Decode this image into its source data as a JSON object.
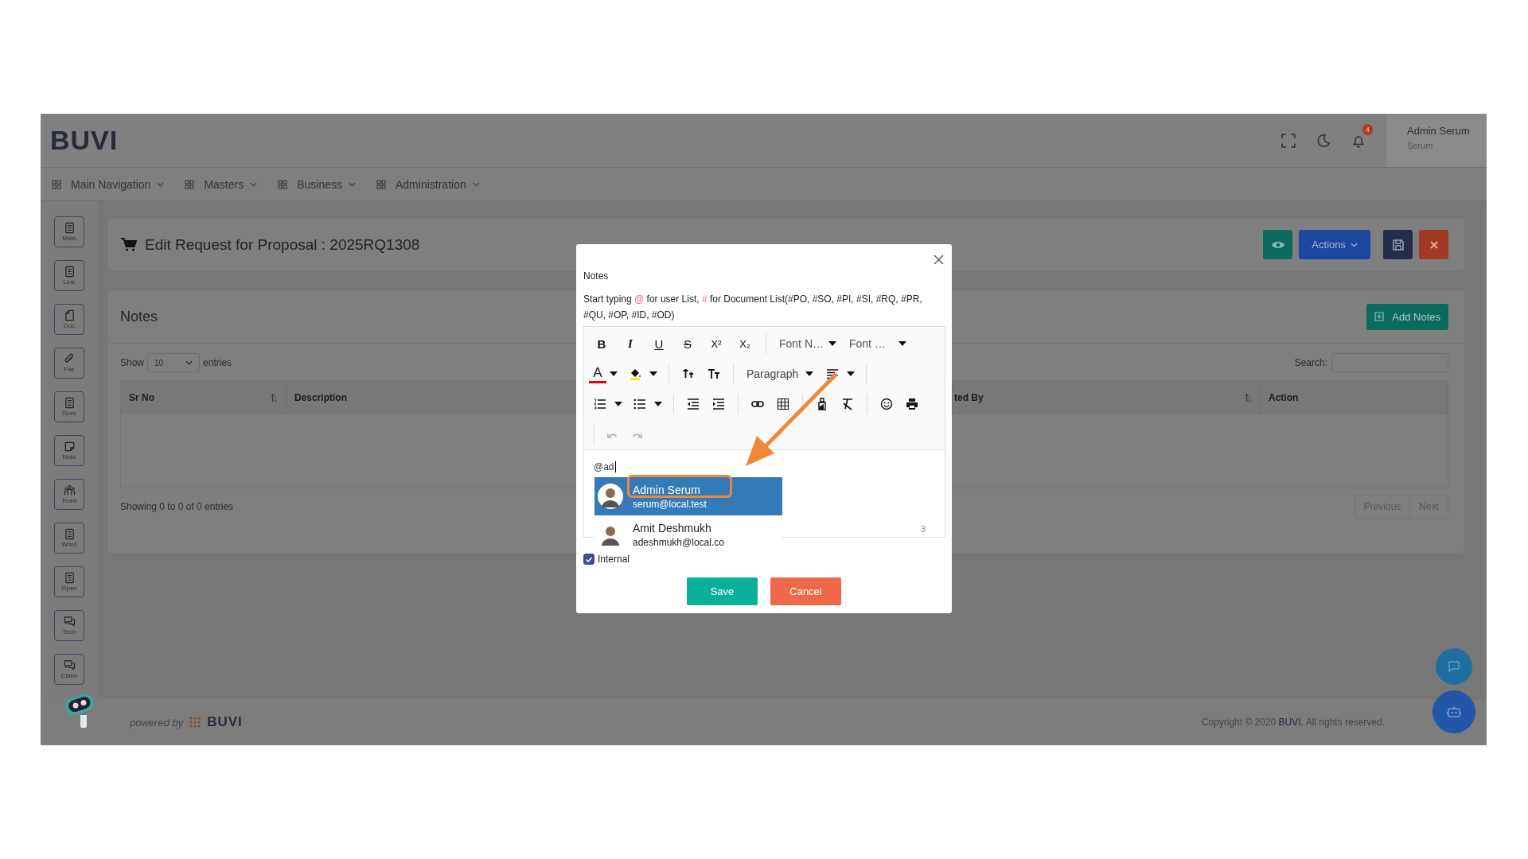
{
  "header": {
    "logo": "BUVI",
    "notification_count": "4",
    "user_name": "Admin Serum",
    "user_role": "Serum"
  },
  "nav": [
    {
      "label": "Main Navigation"
    },
    {
      "label": "Masters"
    },
    {
      "label": "Business"
    },
    {
      "label": "Administration"
    }
  ],
  "sidebar": [
    {
      "label": "Main",
      "kind": "list"
    },
    {
      "label": "Line",
      "kind": "list"
    },
    {
      "label": "Doc",
      "kind": "doc"
    },
    {
      "label": "File",
      "kind": "clip"
    },
    {
      "label": "Spec",
      "kind": "list"
    },
    {
      "label": "Note",
      "kind": "note"
    },
    {
      "label": "Team",
      "kind": "team"
    },
    {
      "label": "Word",
      "kind": "list"
    },
    {
      "label": "Open",
      "kind": "list"
    },
    {
      "label": "Tech",
      "kind": "chat"
    },
    {
      "label": "Claim",
      "kind": "chat"
    }
  ],
  "page": {
    "title": "Edit Request for Proposal : 2025RQ1308",
    "actions_label": "Actions"
  },
  "notes": {
    "title": "Notes",
    "add_label": "Add Notes",
    "show_label": "Show",
    "page_size": "10",
    "entries_label": "entries",
    "search_label": "Search:",
    "columns": [
      {
        "label": "Sr No",
        "sortable": true
      },
      {
        "label": "Description"
      },
      {
        "label": "ted By",
        "sortable": true
      },
      {
        "label": "Action",
        "sortable": false
      }
    ],
    "info": "Showing 0 to 0 of 0 entries",
    "pagination": [
      "Previous",
      "Next"
    ]
  },
  "modal": {
    "title": "Notes",
    "hint": [
      {
        "text": "Start typing ",
        "marked": false
      },
      {
        "text": "@",
        "marked": true
      },
      {
        "text": " for user List, ",
        "marked": false
      },
      {
        "text": "#",
        "marked": true
      },
      {
        "text": " for Document List(#PO, #SO, #PI, #SI, #RQ, #PR, #QU, #OP, #ID, #OD)",
        "marked": false
      }
    ],
    "format_buttons": [
      "B",
      "I",
      "U",
      "S",
      "X²",
      "X₂"
    ],
    "font_name": "Font N…",
    "font_size": "Font …",
    "text_color": "A",
    "block": "Paragraph",
    "content": "@ad",
    "mentions": [
      {
        "name": "Admin Serum",
        "email": "serum@local.test",
        "selected": true
      },
      {
        "name": "Amit Deshmukh",
        "email": "adeshmukh@local.co",
        "selected": false
      }
    ],
    "word_count": "3",
    "internal": {
      "label": "Internal",
      "checked": true
    },
    "save_label": "Save",
    "cancel_label": "Cancel"
  },
  "footer": {
    "powered_by": "powered by",
    "logo": "BUVI",
    "copyright": "Copyright © 2020 **BUVI.** All rights reserved."
  }
}
